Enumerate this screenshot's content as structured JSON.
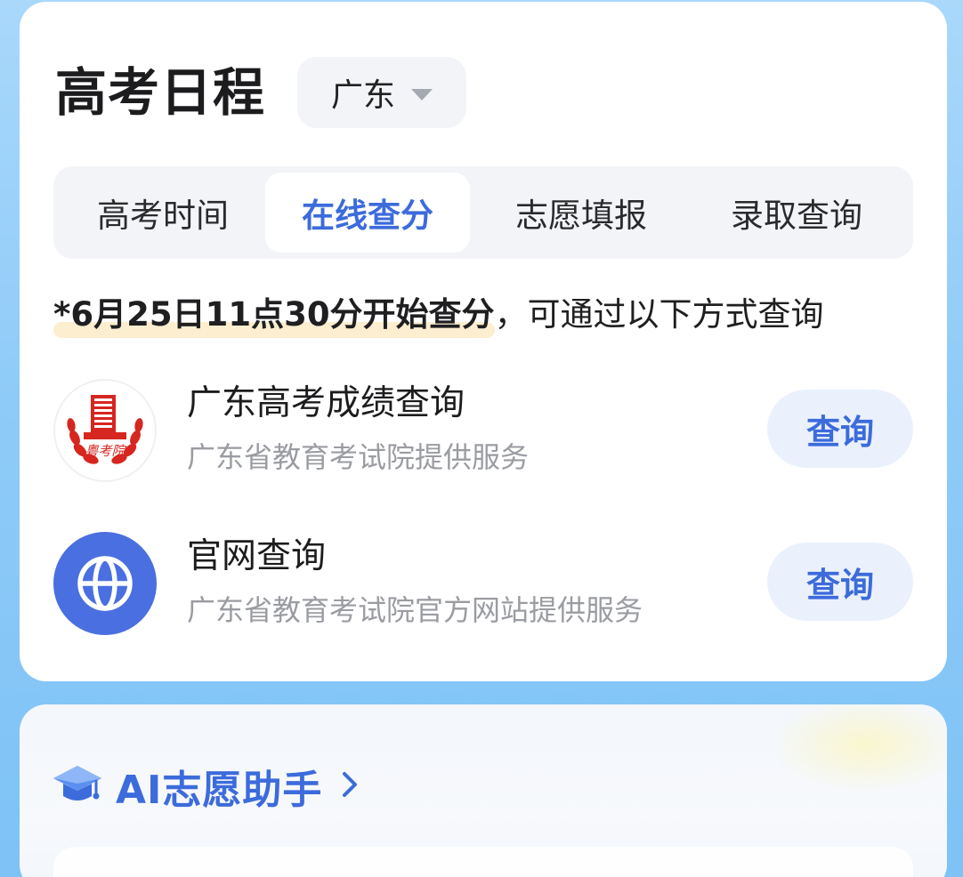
{
  "schedule": {
    "title": "高考日程",
    "province": "广东",
    "tabs": [
      {
        "label": "高考时间"
      },
      {
        "label": "在线查分"
      },
      {
        "label": "志愿填报"
      },
      {
        "label": "录取查询"
      }
    ],
    "active_tab": "在线查分",
    "notice": {
      "highlight": "*6月25日11点30分开始查分",
      "rest": "，可通过以下方式查询"
    },
    "services": [
      {
        "name": "广东高考成绩查询",
        "description": "广东省教育考试院提供服务",
        "button_label": "查询",
        "logo": "exam-authority-seal-icon",
        "logo_text": "粤考院"
      },
      {
        "name": "官网查询",
        "description": "广东省教育考试院官方网站提供服务",
        "button_label": "查询",
        "logo": "globe-icon"
      }
    ]
  },
  "ai_assistant": {
    "title": "AI志愿助手",
    "icon": "graduation-cap-icon"
  },
  "colors": {
    "accent": "#3c6bdb",
    "button_bg": "#eaf1fd",
    "highlight": "#fdeed0",
    "globe_bg": "#4a6fe0",
    "seal_red": "#d6261f"
  }
}
